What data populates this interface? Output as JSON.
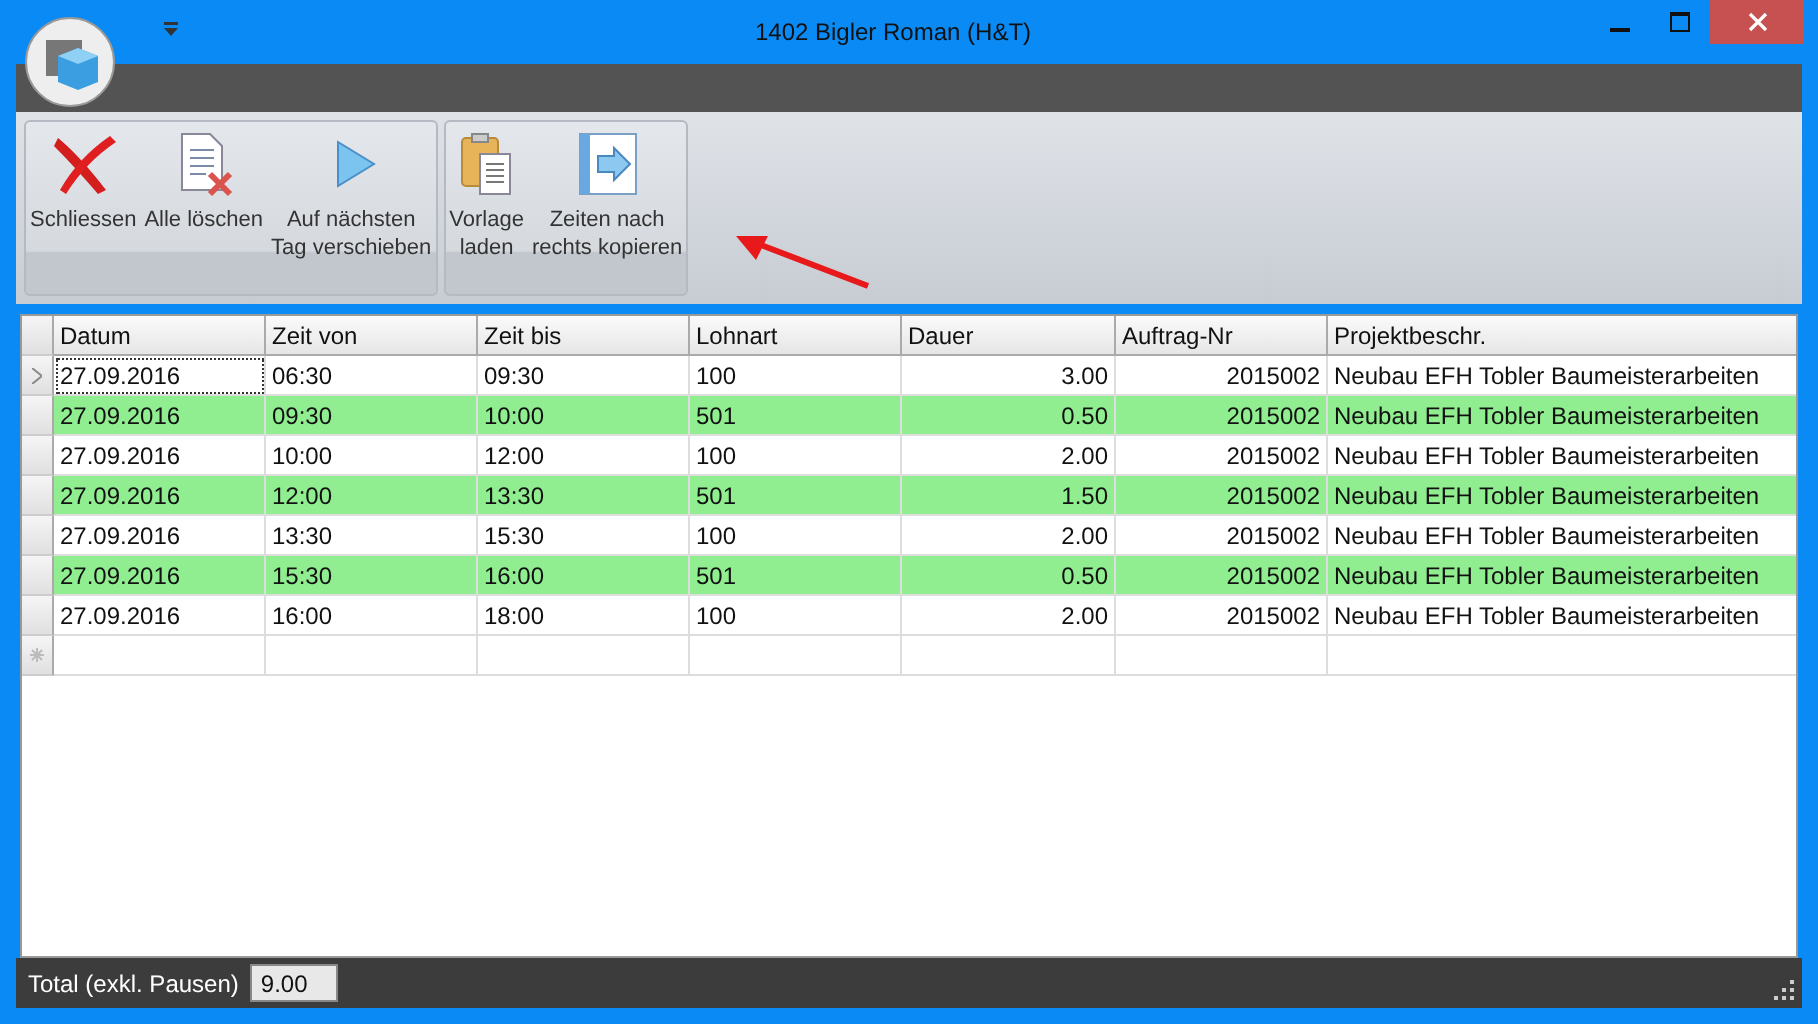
{
  "window": {
    "title": "1402 Bigler Roman (H&T)"
  },
  "ribbon_groups": [
    {
      "buttons": [
        {
          "kind": "close",
          "label": "Schliessen"
        },
        {
          "kind": "clear",
          "label": "Alle löschen"
        },
        {
          "kind": "next",
          "label": "Auf nächsten\nTag verschieben"
        }
      ]
    },
    {
      "buttons": [
        {
          "kind": "template",
          "label": "Vorlage\nladen"
        },
        {
          "kind": "copy",
          "label": "Zeiten nach\nrechts kopieren"
        }
      ]
    }
  ],
  "table": {
    "columns": [
      "Datum",
      "Zeit von",
      "Zeit bis",
      "Lohnart",
      "Dauer",
      "Auftrag-Nr",
      "Projektbeschr."
    ],
    "rows": [
      {
        "selected": true,
        "highlighted": false,
        "cells": [
          "27.09.2016",
          "06:30",
          "09:30",
          "100",
          "3.00",
          "2015002",
          "Neubau EFH Tobler Baumeisterarbeiten"
        ]
      },
      {
        "selected": false,
        "highlighted": true,
        "cells": [
          "27.09.2016",
          "09:30",
          "10:00",
          "501",
          "0.50",
          "2015002",
          "Neubau EFH Tobler Baumeisterarbeiten"
        ]
      },
      {
        "selected": false,
        "highlighted": false,
        "cells": [
          "27.09.2016",
          "10:00",
          "12:00",
          "100",
          "2.00",
          "2015002",
          "Neubau EFH Tobler Baumeisterarbeiten"
        ]
      },
      {
        "selected": false,
        "highlighted": true,
        "cells": [
          "27.09.2016",
          "12:00",
          "13:30",
          "501",
          "1.50",
          "2015002",
          "Neubau EFH Tobler Baumeisterarbeiten"
        ]
      },
      {
        "selected": false,
        "highlighted": false,
        "cells": [
          "27.09.2016",
          "13:30",
          "15:30",
          "100",
          "2.00",
          "2015002",
          "Neubau EFH Tobler Baumeisterarbeiten"
        ]
      },
      {
        "selected": false,
        "highlighted": true,
        "cells": [
          "27.09.2016",
          "15:30",
          "16:00",
          "501",
          "0.50",
          "2015002",
          "Neubau EFH Tobler Baumeisterarbeiten"
        ]
      },
      {
        "selected": false,
        "highlighted": false,
        "cells": [
          "27.09.2016",
          "16:00",
          "18:00",
          "100",
          "2.00",
          "2015002",
          "Neubau EFH Tobler Baumeisterarbeiten"
        ]
      }
    ]
  },
  "status_bar": {
    "label": "Total (exkl. Pausen)",
    "value": "9.00"
  }
}
